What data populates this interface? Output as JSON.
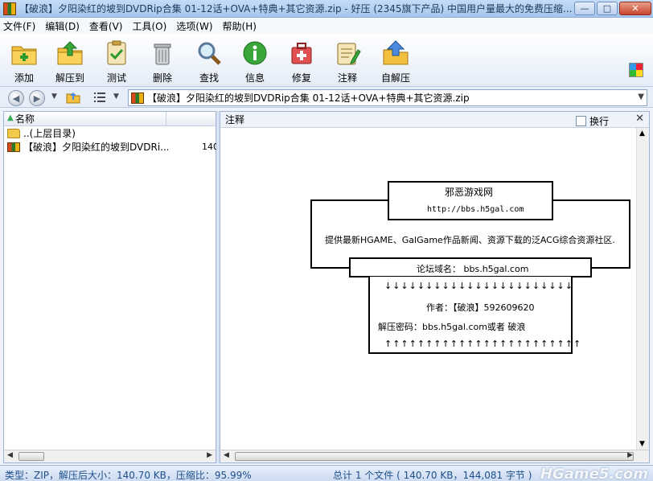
{
  "window": {
    "title": "【破浪】夕阳染红的坡到DVDRip合集 01-12话+OVA+特典+其它资源.zip - 好压 (2345旗下产品) 中国用户量最大的免费压缩..."
  },
  "menu": [
    "文件(F)",
    "编辑(D)",
    "查看(V)",
    "工具(O)",
    "选项(W)",
    "帮助(H)"
  ],
  "toolbar": [
    {
      "label": "添加",
      "icon": "add-icon"
    },
    {
      "label": "解压到",
      "icon": "extract-to-icon"
    },
    {
      "label": "测试",
      "icon": "test-icon"
    },
    {
      "label": "删除",
      "icon": "delete-icon"
    },
    {
      "label": "查找",
      "icon": "find-icon"
    },
    {
      "label": "信息",
      "icon": "info-icon"
    },
    {
      "label": "修复",
      "icon": "repair-icon"
    },
    {
      "label": "注释",
      "icon": "comment-icon"
    },
    {
      "label": "自解压",
      "icon": "sfx-icon"
    }
  ],
  "address": {
    "path": "【破浪】夕阳染红的坡到DVDRip合集 01-12话+OVA+特典+其它资源.zip"
  },
  "filelist": {
    "header_name": "名称",
    "rows": [
      {
        "name": "..(上层目录)",
        "size": "",
        "type": "folder"
      },
      {
        "name": "【破浪】夕阳染红的坡到DVDRi...",
        "size": "140",
        "type": "zip"
      }
    ]
  },
  "comment": {
    "title": "注释",
    "wrap_label": "换行",
    "lines": {
      "site_name": "邪恶游戏网",
      "site_url": "http://bbs.h5gal.com",
      "description": "提供最新HGAME、GalGame作品新闻、资源下载的泛ACG综合资源社区.",
      "forum_domain": "论坛域名： bbs.h5gal.com",
      "down_arrows": "↓↓↓↓↓↓↓↓↓↓↓↓↓↓↓↓↓↓↓↓↓↓↓",
      "author": "作者：【破浪】592609620",
      "password": "解压密码：bbs.h5gal.com或者 破浪",
      "up_arrows": "↑↑↑↑↑↑↑↑↑↑↑↑↑↑↑↑↑↑↑↑↑↑↑↑"
    }
  },
  "status": {
    "left": "类型：ZIP，解压后大小：140.70 KB，压缩比：95.99%",
    "right": "总计 1 个文件 ( 140.70 KB，144,081 字节 )",
    "watermark": "HGame5.com"
  }
}
